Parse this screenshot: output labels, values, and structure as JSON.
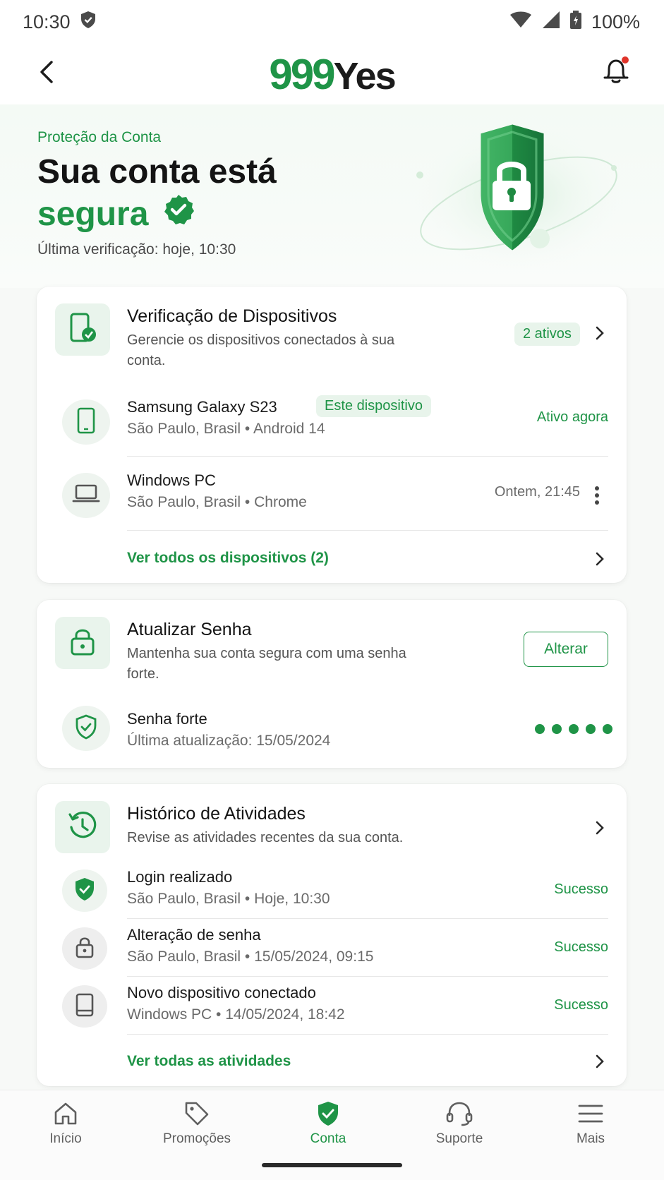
{
  "status_bar": {
    "time": "10:30",
    "battery": "100%"
  },
  "app_bar": {
    "logo_nines": "999",
    "logo_yes": "Yes"
  },
  "hero": {
    "eyebrow": "Proteção da Conta",
    "title_line1": "Sua conta está",
    "title_line2": "segura",
    "last_check": "Última verificação: hoje, 10:30"
  },
  "devices_card": {
    "title": "Verificação de Dispositivos",
    "description": "Gerencie os dispositivos conectados à sua conta.",
    "active_badge": "2 ativos",
    "devices": [
      {
        "name": "Samsung Galaxy S23",
        "tag": "Este dispositivo",
        "location": "São Paulo, Brasil • Android 14",
        "status": "Ativo agora",
        "icon": "smartphone-icon"
      },
      {
        "name": "Windows PC",
        "location": "São Paulo, Brasil • Chrome",
        "status": "Ontem, 21:45",
        "icon": "laptop-icon"
      }
    ],
    "view_all": "Ver todos os dispositivos (2)"
  },
  "password_card": {
    "title": "Atualizar Senha",
    "description": "Mantenha sua conta segura com uma senha forte.",
    "button": "Alterar",
    "strength_title": "Senha forte",
    "last_update": "Última atualização: 15/05/2024",
    "strength_level": 5,
    "strength_max": 5
  },
  "activity_card": {
    "title": "Histórico de Atividades",
    "description": "Revise as atividades recentes da sua conta.",
    "items": [
      {
        "title": "Login realizado",
        "sub": "São Paulo, Brasil • Hoje, 10:30",
        "status": "Sucesso",
        "icon": "shield-check-icon"
      },
      {
        "title": "Alteração de senha",
        "sub": "São Paulo, Brasil • 15/05/2024, 09:15",
        "status": "Sucesso",
        "icon": "lock-icon"
      },
      {
        "title": "Novo dispositivo conectado",
        "sub": "Windows PC • 14/05/2024, 18:42",
        "status": "Sucesso",
        "icon": "tablet-icon"
      }
    ],
    "view_all": "Ver todas as atividades"
  },
  "bottom_nav": [
    {
      "label": "Início",
      "icon": "home-icon"
    },
    {
      "label": "Promoções",
      "icon": "tag-icon"
    },
    {
      "label": "Conta",
      "icon": "shield-icon",
      "active": true
    },
    {
      "label": "Suporte",
      "icon": "headset-icon"
    },
    {
      "label": "Mais",
      "icon": "menu-icon"
    }
  ],
  "colors": {
    "accent": "#1f9447",
    "accent_light": "#e9f4ec",
    "text": "#141414"
  }
}
